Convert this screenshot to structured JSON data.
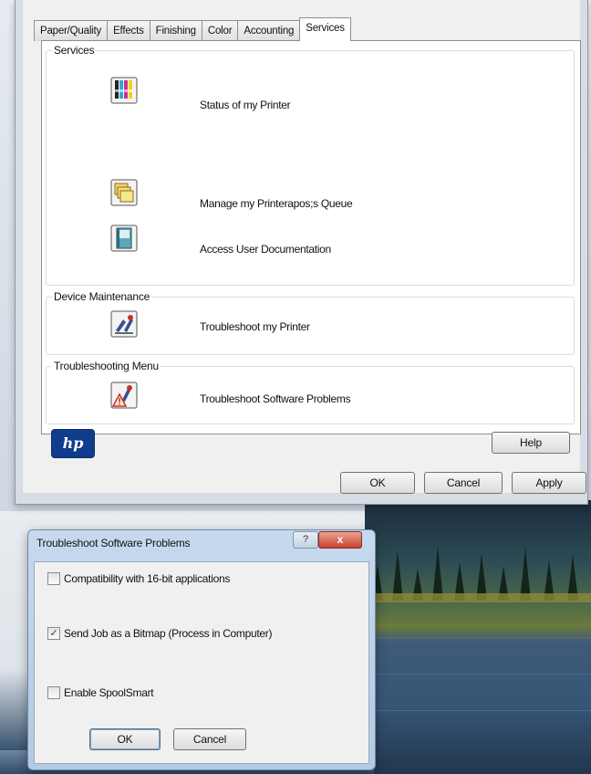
{
  "printer_properties": {
    "tabs": [
      {
        "label": "Paper/Quality",
        "active": false
      },
      {
        "label": "Effects",
        "active": false
      },
      {
        "label": "Finishing",
        "active": false
      },
      {
        "label": "Color",
        "active": false
      },
      {
        "label": "Accounting",
        "active": false
      },
      {
        "label": "Services",
        "active": true
      }
    ],
    "services_group": {
      "label": "Services",
      "items": [
        {
          "icon": "printer-status-icon",
          "label": "Status of my Printer"
        },
        {
          "icon": "print-queue-icon",
          "label": "Manage my Printerapos;s Queue"
        },
        {
          "icon": "user-documentation-icon",
          "label": "Access User Documentation"
        }
      ]
    },
    "device_maintenance_group": {
      "label": "Device Maintenance",
      "items": [
        {
          "icon": "troubleshoot-printer-icon",
          "label": "Troubleshoot my Printer"
        }
      ]
    },
    "troubleshooting_menu_group": {
      "label": "Troubleshooting Menu",
      "items": [
        {
          "icon": "troubleshoot-software-icon",
          "label": "Troubleshoot Software Problems"
        }
      ]
    },
    "logo": "hp",
    "buttons": {
      "help": "Help",
      "ok": "OK",
      "cancel": "Cancel",
      "apply": "Apply"
    }
  },
  "troubleshoot_dialog": {
    "title": "Troubleshoot Software Problems",
    "help_glyph": "?",
    "close_glyph": "x",
    "options": [
      {
        "label": "Compatibility with 16-bit applications",
        "checked": false
      },
      {
        "label": "Send Job as a Bitmap (Process in Computer)",
        "checked": true
      },
      {
        "label": "Enable SpoolSmart",
        "checked": false
      }
    ],
    "buttons": {
      "ok": "OK",
      "cancel": "Cancel"
    }
  },
  "colors": {
    "hp_blue": "#0f3c8c",
    "close_red": "#c9412c",
    "dialog_frame": "#b3cae4"
  }
}
